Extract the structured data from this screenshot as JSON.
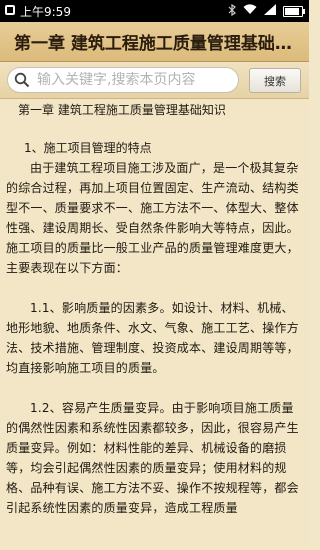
{
  "status_bar": {
    "time": "上午9:59",
    "icons": [
      "bluetooth-icon",
      "wifi-icon",
      "signal-icon",
      "battery-icon"
    ],
    "battery_level": 0.85
  },
  "title": "第一章 建筑工程施工质量管理基础知识",
  "search": {
    "placeholder": "输入关键字,搜索本页内容",
    "button_label": "搜索"
  },
  "content": {
    "heading": "第一章 建筑工程施工质量管理基础知识",
    "section_title": "1、施工项目管理的特点",
    "paragraphs": [
      "由于建筑工程项目施工涉及面广，是一个极其复杂的综合过程，再加上项目位置固定、生产流动、结构类型不一、质量要求不一、施工方法不一、体型大、整体性强、建设周期长、受自然条件影响大等特点，因此。施工项目的质量比一般工业产品的质量管理难度更大，主要表现在以下方面：",
      "1.1、影响质量的因素多。如设计、材料、机械、地形地貌、地质条件、水文、气象、施工工艺、操作方法、技术措施、管理制度、投资成本、建设周期等等，均直接影响施工项目的质量。",
      "1.2、容易产生质量变异。由于影响项目施工质量的偶然性因素和系统性因素都较多，因此，很容易产生质量变异。例如：材料性能的差异、机械设备的磨损等，均会引起偶然性因素的质量变异；使用材料的规格、品种有误、施工方法不妥、操作不按规程等，都会引起系统性因素的质量变异，造成工程质量"
    ]
  },
  "colors": {
    "status_bar_bg": "#000000",
    "title_bar_bg": "#e2c488",
    "content_bg": "#f3e6c6",
    "text": "#1f1a12"
  }
}
